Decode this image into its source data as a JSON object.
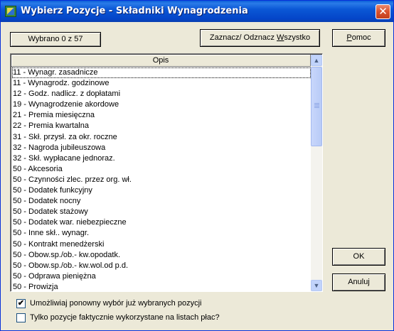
{
  "window": {
    "title": "Wybierz Pozycje - Składniki Wynagrodzenia",
    "close_glyph": "✕"
  },
  "toolbar": {
    "selected_count_label": "Wybrano 0 z 57",
    "toggle_all_label_prefix": "Zaznacz/ Odznacz ",
    "toggle_all_label_hotkey": "W",
    "toggle_all_label_suffix": "szystko",
    "help_label_hotkey": "P",
    "help_label_suffix": "omoc"
  },
  "list": {
    "column_header": "Opis",
    "rows": [
      "11 - Wynagr. zasadnicze",
      "11 - Wynagrodz. godzinowe",
      "12 - Godz. nadlicz. z dopłatami",
      "19 - Wynagrodzenie akordowe",
      "21 - Premia miesięczna",
      "22 - Premia kwartalna",
      "31 - Skł. przysł. za okr. roczne",
      "32 - Nagroda jubileuszowa",
      "32 - Skł. wypłacane jednoraz.",
      "50 - Akcesoria",
      "50 - Czynności zlec. przez org. wł.",
      "50 - Dodatek funkcyjny",
      "50 - Dodatek nocny",
      "50 - Dodatek stażowy",
      "50 - Dodatek war. niebezpieczne",
      "50 - Inne skł.. wynagr.",
      "50 - Kontrakt menedżerski",
      "50 - Obow.sp./ob.- kw.opodatk.",
      "50 - Obow.sp./ob.- kw.wol.od p.d.",
      "50 - Odprawa pieniężna",
      "50 - Prowizja"
    ],
    "focused_row": 0
  },
  "actions": {
    "ok_label": "OK",
    "cancel_label": "Anuluj"
  },
  "options": {
    "allow_reselect_label": "Umożliwiaj ponowny wybór już wybranych pozycji",
    "allow_reselect_checked": true,
    "only_used_label": "Tylko pozycje faktycznie wykorzystane na listach płac?",
    "only_used_checked": false,
    "check_glyph": "✔"
  },
  "scrollbar": {
    "up_glyph": "▲",
    "down_glyph": "▼"
  }
}
